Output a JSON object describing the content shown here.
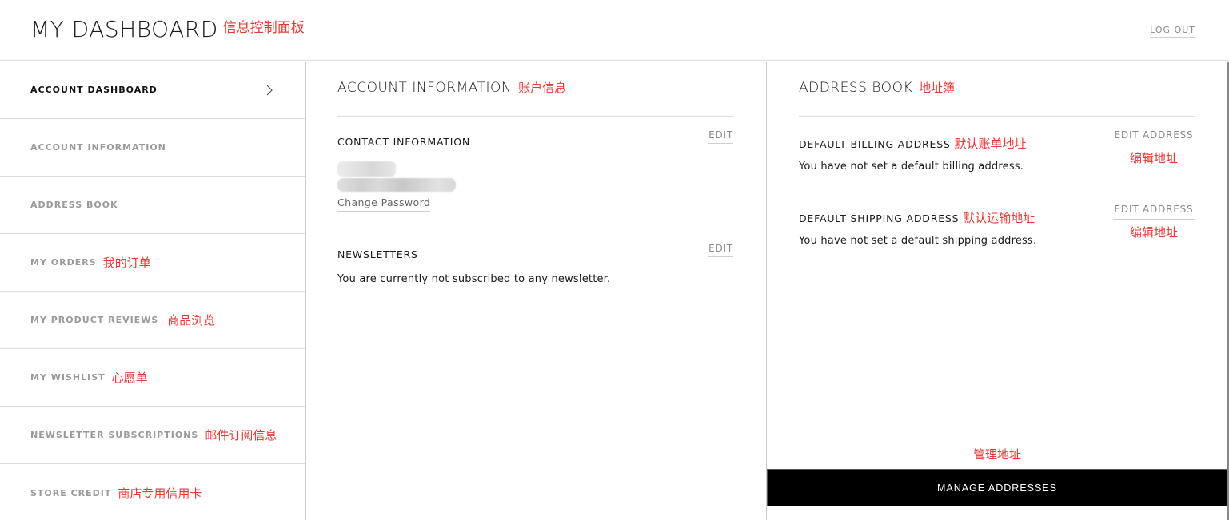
{
  "header": {
    "title": "MY DASHBOARD",
    "title_annotation": "信息控制面板",
    "logout_label": "LOG OUT"
  },
  "sidebar": {
    "items": [
      {
        "label": "ACCOUNT DASHBOARD",
        "annotation": "",
        "active": true
      },
      {
        "label": "ACCOUNT INFORMATION",
        "annotation": ""
      },
      {
        "label": "ADDRESS BOOK",
        "annotation": ""
      },
      {
        "label": "MY ORDERS",
        "annotation": "我的订单"
      },
      {
        "label": "MY PRODUCT REVIEWS",
        "annotation": "商品浏览"
      },
      {
        "label": "MY WISHLIST",
        "annotation": "心愿单"
      },
      {
        "label": "NEWSLETTER SUBSCRIPTIONS",
        "annotation": "邮件订阅信息"
      },
      {
        "label": "STORE CREDIT",
        "annotation": "商店专用信用卡"
      }
    ]
  },
  "account_info": {
    "title": "ACCOUNT INFORMATION",
    "title_annotation": "账户信息",
    "contact": {
      "heading": "CONTACT INFORMATION",
      "edit_label": "EDIT",
      "change_password_label": "Change Password"
    },
    "newsletters": {
      "heading": "NEWSLETTERS",
      "edit_label": "EDIT",
      "status_text": "You are currently not subscribed to any newsletter."
    }
  },
  "address_book": {
    "title": "ADDRESS BOOK",
    "title_annotation": "地址簿",
    "billing": {
      "heading": "DEFAULT BILLING ADDRESS",
      "heading_annotation": "默认账单地址",
      "text": "You have not set a default billing address.",
      "edit_label": "EDIT ADDRESS",
      "edit_annotation": "编辑地址"
    },
    "shipping": {
      "heading": "DEFAULT SHIPPING ADDRESS",
      "heading_annotation": "默认运输地址",
      "text": "You have not set a default shipping address.",
      "edit_label": "EDIT ADDRESS",
      "edit_annotation": "编辑地址"
    },
    "manage_annotation": "管理地址",
    "manage_button_label": "MANAGE ADDRESSES"
  },
  "colors": {
    "annotation": "#e53935",
    "button_bg": "#000000",
    "muted_text": "#9a9a9a"
  }
}
